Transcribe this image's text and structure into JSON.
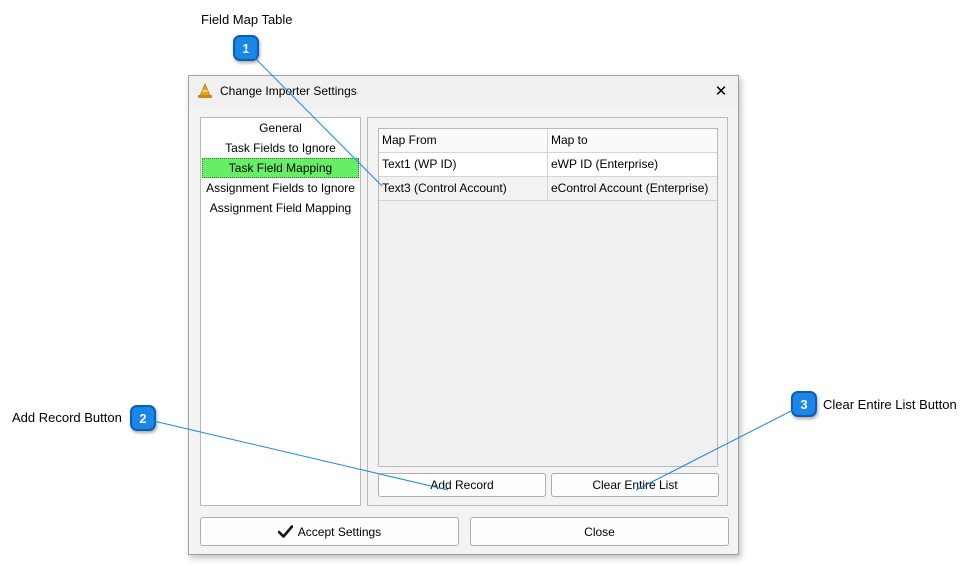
{
  "callouts": {
    "field_map_table": {
      "number": "1",
      "label": "Field Map Table"
    },
    "add_record": {
      "number": "2",
      "label": "Add Record Button"
    },
    "clear_list": {
      "number": "3",
      "label": "Clear Entire List Button"
    }
  },
  "dialog": {
    "title": "Change Importer Settings",
    "close_glyph": "✕",
    "sidebar": {
      "items": [
        {
          "label": "General"
        },
        {
          "label": "Task Fields to Ignore"
        },
        {
          "label": "Task Field Mapping"
        },
        {
          "label": "Assignment Fields to Ignore"
        },
        {
          "label": "Assignment Field Mapping"
        }
      ],
      "selected_index": 2,
      "selected_color": "#66ee66"
    },
    "table": {
      "columns": [
        "Map From",
        "Map to"
      ],
      "rows": [
        [
          "Text1 (WP ID)",
          "eWP ID (Enterprise)"
        ],
        [
          "Text3 (Control Account)",
          "eControl Account (Enterprise)"
        ]
      ]
    },
    "add_record_label": "Add Record",
    "clear_list_label": "Clear Entire List",
    "accept_label": "Accept Settings",
    "accept_icon": "checkmark-icon",
    "close_label": "Close"
  },
  "colors": {
    "badge": "#1a86e8",
    "leader_line": "#1a86e8"
  }
}
